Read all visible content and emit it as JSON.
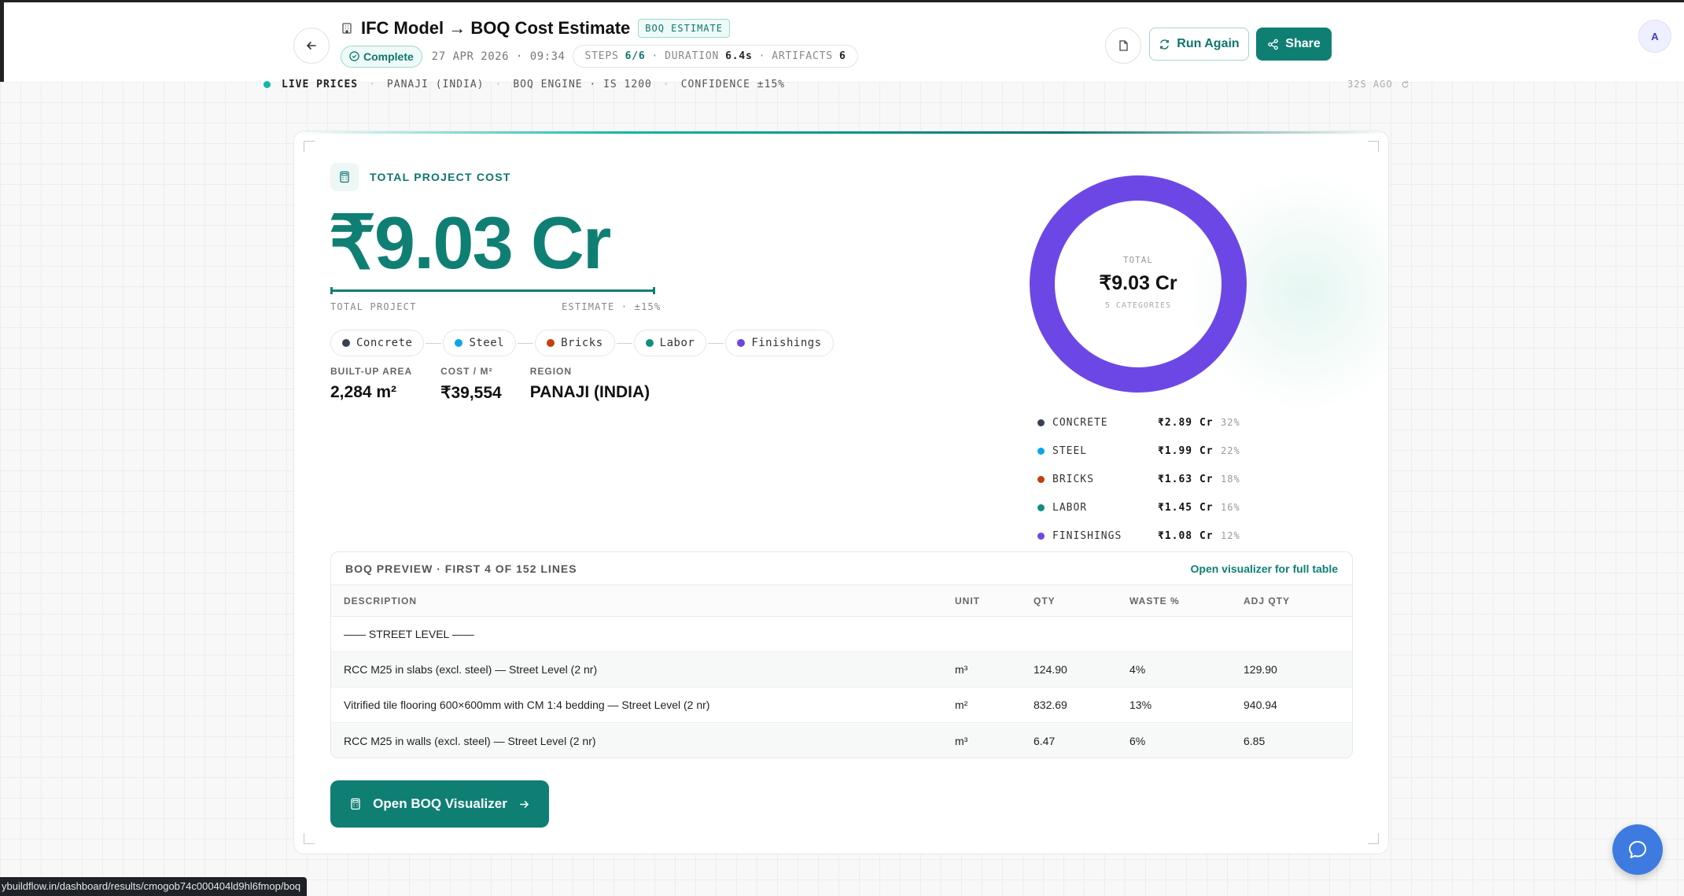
{
  "header": {
    "title": "IFC Model → BOQ Cost Estimate",
    "tag": "BOQ ESTIMATE",
    "status": "Complete",
    "datetime": "27 APR 2026 · 09:34",
    "steps_label": "STEPS",
    "steps_value": "6/6",
    "duration_label": "DURATION",
    "duration_value": "6.4s",
    "artifacts_label": "ARTIFACTS",
    "artifacts_value": "6",
    "run_again": "Run Again",
    "share": "Share",
    "avatar_initial": "A"
  },
  "live_strip": {
    "live": "LIVE PRICES",
    "region": "PANAJI (INDIA)",
    "engine": "BOQ ENGINE · IS 1200",
    "confidence": "CONFIDENCE ±15%",
    "ago": "32S AGO"
  },
  "summary": {
    "label": "TOTAL PROJECT COST",
    "total": "₹9.03 Cr",
    "total_project": "TOTAL PROJECT",
    "estimate": "ESTIMATE · ±15%",
    "chips": [
      "Concrete",
      "Steel",
      "Bricks",
      "Labor",
      "Finishings"
    ],
    "stats": [
      {
        "label": "BUILT-UP AREA",
        "value": "2,284 m²"
      },
      {
        "label": "COST / M²",
        "value": "₹39,554"
      },
      {
        "label": "REGION",
        "value": "PANAJI (INDIA)"
      }
    ]
  },
  "donut": {
    "center_label": "TOTAL",
    "center_value": "₹9.03 Cr",
    "center_sub": "5 CATEGORIES",
    "ring_color": "#6d47e6"
  },
  "legend": [
    {
      "name": "CONCRETE",
      "value": "₹2.89 Cr",
      "pct": "32%",
      "color": "#374151"
    },
    {
      "name": "STEEL",
      "value": "₹1.99 Cr",
      "pct": "22%",
      "color": "#0ea5e9"
    },
    {
      "name": "BRICKS",
      "value": "₹1.63 Cr",
      "pct": "18%",
      "color": "#c2410c"
    },
    {
      "name": "LABOR",
      "value": "₹1.45 Cr",
      "pct": "16%",
      "color": "#0f8f7f"
    },
    {
      "name": "FINISHINGS",
      "value": "₹1.08 Cr",
      "pct": "12%",
      "color": "#6d47e6"
    }
  ],
  "boq": {
    "title": "BOQ PREVIEW · FIRST 4 OF 152 LINES",
    "link": "Open visualizer for full table",
    "columns": [
      "DESCRIPTION",
      "UNIT",
      "QTY",
      "WASTE %",
      "ADJ QTY"
    ],
    "section": "—— STREET LEVEL ——",
    "rows": [
      [
        "RCC M25 in slabs (excl. steel) — Street Level (2 nr)",
        "m³",
        "124.90",
        "4%",
        "129.90"
      ],
      [
        "Vitrified tile flooring 600×600mm with CM 1:4 bedding — Street Level (2 nr)",
        "m²",
        "832.69",
        "13%",
        "940.94"
      ],
      [
        "RCC M25 in walls (excl. steel) — Street Level (2 nr)",
        "m³",
        "6.47",
        "6%",
        "6.85"
      ]
    ]
  },
  "open_button": "Open BOQ Visualizer",
  "status_url": "ybuildflow.in/dashboard/results/cmogob74c000404ld9hl6fmop/boq",
  "colors": {
    "accent": "#0f7f74",
    "donut": "#6d47e6"
  }
}
